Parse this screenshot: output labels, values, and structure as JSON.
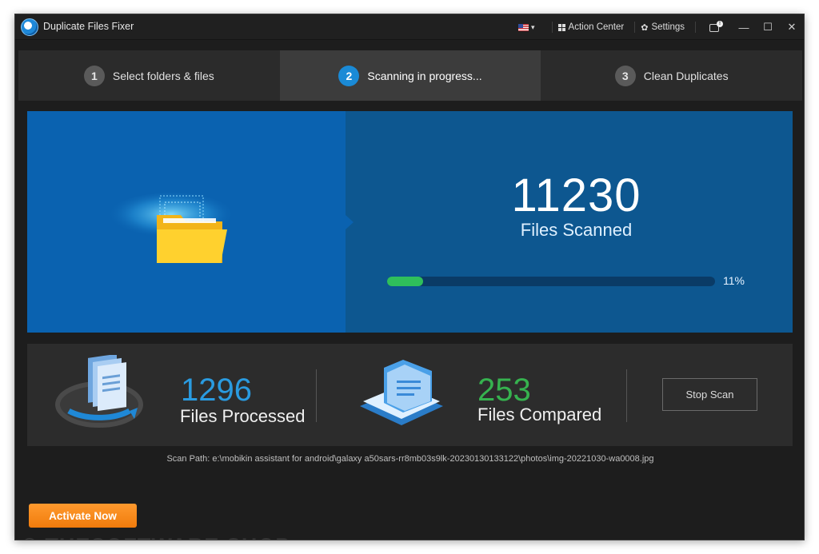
{
  "window": {
    "title": "Duplicate Files Fixer"
  },
  "titlebar": {
    "language_icon": "us-flag-icon",
    "action_center_label": "Action Center",
    "settings_label": "Settings",
    "notification_badge": "!",
    "minimize": "—",
    "maximize": "☐",
    "close": "✕"
  },
  "steps": [
    {
      "number": "1",
      "label": "Select folders & files",
      "active": false
    },
    {
      "number": "2",
      "label": "Scanning in progress...",
      "active": true
    },
    {
      "number": "3",
      "label": "Clean Duplicates",
      "active": false
    }
  ],
  "scan": {
    "files_scanned": "11230",
    "files_scanned_label": "Files Scanned",
    "progress_percent": 11,
    "progress_label": "11%"
  },
  "stats": {
    "processed_value": "1296",
    "processed_label": "Files Processed",
    "compared_value": "253",
    "compared_label": "Files Compared",
    "stop_label": "Stop Scan"
  },
  "scan_path": "Scan Path: e:\\mobikin assistant for android\\galaxy a50sars-rr8mb03s9lk-20230130133122\\photos\\img-20221030-wa0008.jpg",
  "activate_label": "Activate Now",
  "watermark": "© THESOFTWARE.SHOP",
  "colors": {
    "accent_blue": "#1a8ad6",
    "panel_blue": "#0d5790",
    "progress_green": "#2fbf5b",
    "processed_blue": "#2a9be0",
    "compared_green": "#36b24f",
    "activate_orange": "#f5891d"
  }
}
